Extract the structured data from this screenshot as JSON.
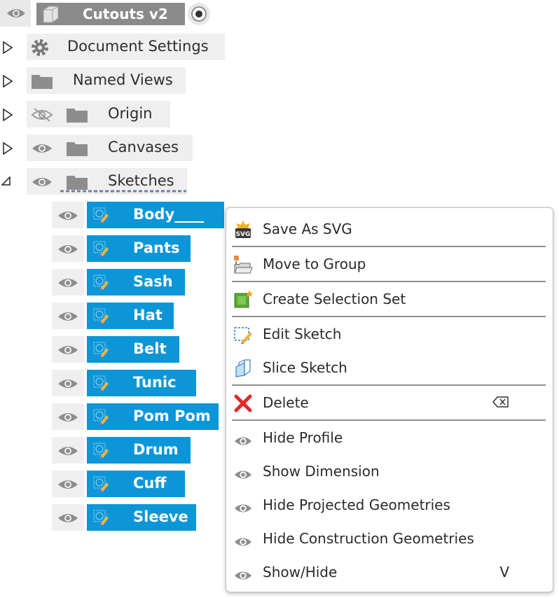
{
  "root": {
    "title": "Cutouts v2",
    "icons": [
      "eye-icon",
      "box-icon",
      "radio-icon"
    ]
  },
  "tree": {
    "nodes": [
      {
        "label": "Document Settings",
        "icon": "gear-icon"
      },
      {
        "label": "Named Views",
        "icon": "folder-icon"
      },
      {
        "label": "Origin",
        "icon": "folder-icon",
        "visibility": "hidden-eye-icon"
      },
      {
        "label": "Canvases",
        "icon": "folder-icon",
        "visibility": "eye-icon"
      },
      {
        "label": "Sketches",
        "icon": "folder-icon",
        "visibility": "eye-icon",
        "expanded": true
      }
    ],
    "sketches": [
      "Body____",
      "Pants",
      "Sash",
      "Hat",
      "Belt",
      "Tunic",
      "Pom Pom",
      "Drum",
      "Cuff",
      "Sleeve"
    ]
  },
  "context_menu": {
    "items": [
      {
        "label": "Save As SVG",
        "icon": "svg-icon"
      },
      {
        "label": "Move to Group",
        "icon": "move-group-icon"
      },
      {
        "label": "Create Selection Set",
        "icon": "selection-set-icon"
      },
      {
        "label": "Edit Sketch",
        "icon": "edit-sketch-icon"
      },
      {
        "label": "Slice Sketch",
        "icon": "slice-icon"
      },
      {
        "label": "Delete",
        "icon": "delete-x-icon",
        "shortcut_icon": "delete-key-icon"
      },
      {
        "label": "Hide Profile",
        "icon": "eye-icon"
      },
      {
        "label": "Show Dimension",
        "icon": "eye-icon"
      },
      {
        "label": "Hide Projected Geometries",
        "icon": "eye-icon"
      },
      {
        "label": "Hide Construction Geometries",
        "icon": "eye-icon"
      },
      {
        "label": "Show/Hide",
        "icon": "eye-icon",
        "shortcut": "V"
      }
    ]
  },
  "colors": {
    "selection": "#0c96d7",
    "row_bg": "#efefef",
    "root_bg": "#8a8a8a",
    "delete_red": "#e02828"
  }
}
